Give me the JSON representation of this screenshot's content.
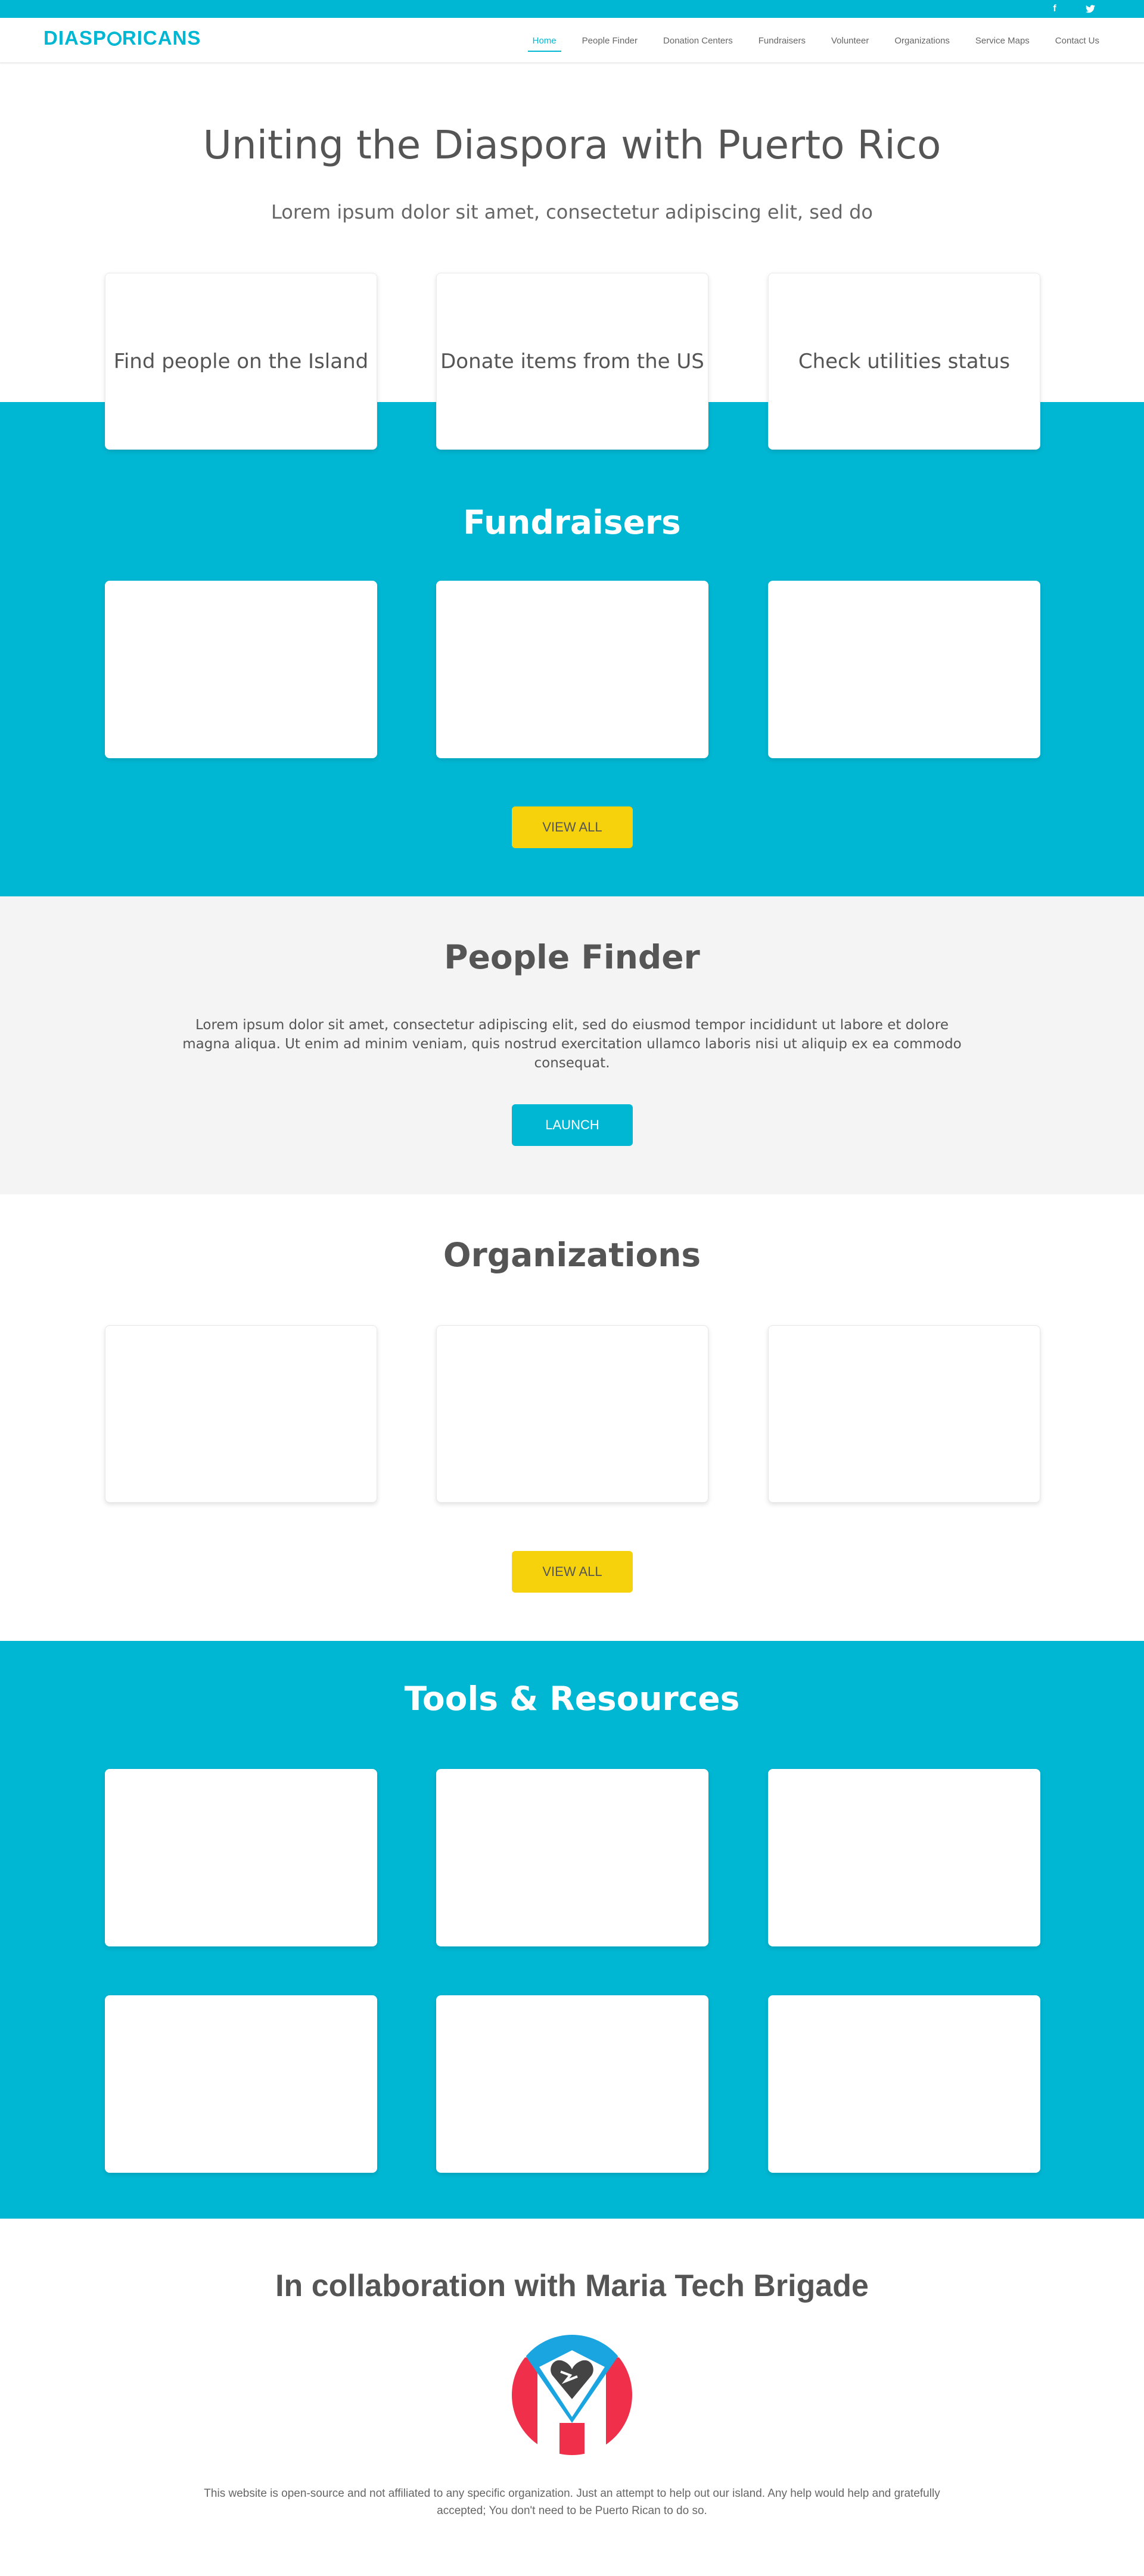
{
  "social": {
    "facebook": "f",
    "twitter": "🐦"
  },
  "logo": {
    "pre": "DIASP",
    "post": "RICANS"
  },
  "nav": [
    {
      "label": "Home",
      "active": true
    },
    {
      "label": "People Finder"
    },
    {
      "label": "Donation Centers"
    },
    {
      "label": "Fundraisers"
    },
    {
      "label": "Volunteer"
    },
    {
      "label": "Organizations"
    },
    {
      "label": "Service Maps"
    },
    {
      "label": "Contact Us"
    }
  ],
  "hero": {
    "title": "Uniting the Diaspora with Puerto Rico",
    "subtitle": "Lorem ipsum dolor sit amet, consectetur adipiscing elit, sed do"
  },
  "features": [
    "Find people on the Island",
    "Donate items from the US",
    "Check utilities status"
  ],
  "fundraisers": {
    "title": "Fundraisers",
    "button": "VIEW ALL"
  },
  "people_finder": {
    "title": "People Finder",
    "text": "Lorem ipsum dolor sit amet, consectetur adipiscing elit, sed do eiusmod tempor incididunt ut labore et dolore magna aliqua. Ut enim ad minim veniam, quis nostrud exercitation ullamco laboris nisi ut aliquip ex ea commodo consequat.",
    "button": "LAUNCH"
  },
  "organizations": {
    "title": "Organizations",
    "button": "VIEW ALL"
  },
  "tools": {
    "title": "Tools & Resources"
  },
  "collab": {
    "title": "In collaboration with Maria Tech Brigade"
  },
  "footer": {
    "text": "This website is open-source and not affiliated to any specific organization. Just an attempt to help out our island. Any help would help and gratefully accepted; You don't need to be Puerto Rican to do so."
  },
  "colors": {
    "accent": "#00b7d3",
    "button_yellow": "#f5d20b",
    "grey_band": "#f4f4f4",
    "emblem_red": "#f0304a",
    "emblem_blue": "#1aa4e0"
  }
}
